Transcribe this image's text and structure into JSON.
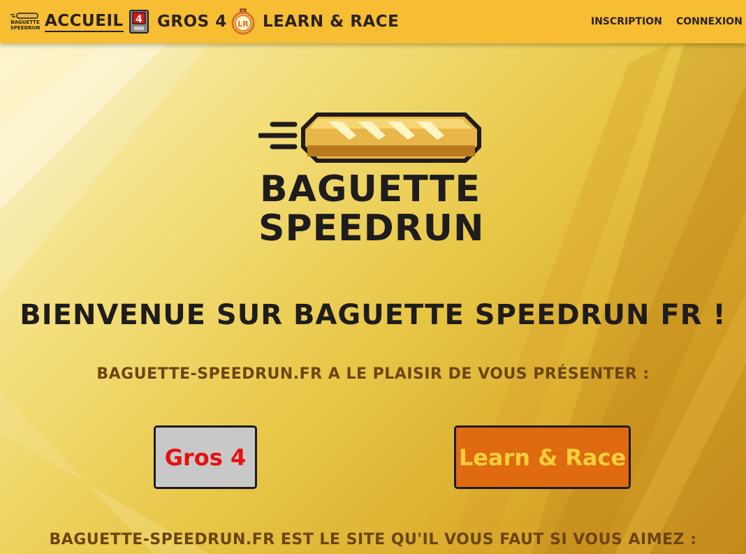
{
  "nav": {
    "logo_text": "BAGUETTE SPEEDRUN",
    "items": [
      {
        "label": "ACCUEIL",
        "icon": "baguette-logo-icon",
        "active": true
      },
      {
        "label": "GROS 4",
        "icon": "gros4-icon"
      },
      {
        "label": "LEARN & RACE",
        "icon": "stopwatch-icon"
      }
    ],
    "right": [
      {
        "label": "INSCRIPTION"
      },
      {
        "label": "CONNEXION"
      }
    ]
  },
  "hero": {
    "logo_line1": "BAGUETTE",
    "logo_line2": "SPEEDRUN",
    "welcome": "BIENVENUE SUR BAGUETTE SPEEDRUN FR !",
    "intro": "BAGUETTE-SPEEDRUN.FR A LE PLAISIR DE VOUS PRéSENTER :",
    "buttons": [
      {
        "label": "Gros 4"
      },
      {
        "label": "Learn & Race"
      }
    ],
    "tagline": "BAGUETTE-SPEEDRUN.FR EST LE SITE QU'IL VOUS FAUT SI VOUS AIMEZ :"
  },
  "colors": {
    "navbar": "#f7bd33",
    "text_dark": "#1e1c1c",
    "text_brown": "#6b4513",
    "gros4_bg": "#c8c8c8",
    "gros4_text": "#e51010",
    "learn_bg": "#e06a10",
    "learn_text": "#f8cf3b"
  }
}
